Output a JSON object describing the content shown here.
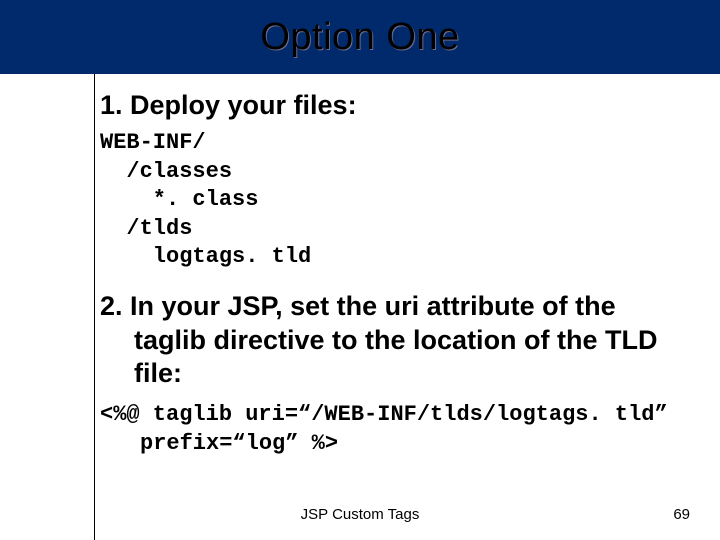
{
  "title": "Option One",
  "step1": {
    "heading": "1. Deploy your files:",
    "lines": "WEB-INF/\n  /classes\n    *. class\n  /tlds\n    logtags. tld"
  },
  "step2": {
    "heading_l1": "2. In your JSP, set the uri attribute of the",
    "heading_l2": "taglib directive to the location of the TLD",
    "heading_l3": "file:",
    "code_l1": "<%@ taglib uri=“/WEB-INF/tlds/logtags. tld”",
    "code_l2": "prefix=“log” %>"
  },
  "footer": {
    "center": "JSP Custom Tags",
    "page": "69"
  }
}
